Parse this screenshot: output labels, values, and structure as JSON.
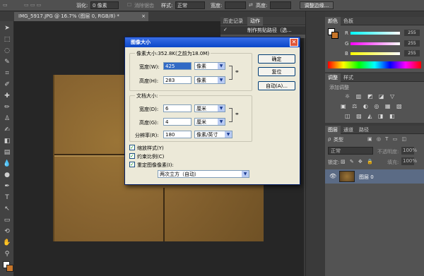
{
  "options_bar": {
    "feather_label": "羽化:",
    "feather_value": "0 像素",
    "antialias_label": "消除锯齿",
    "style_label": "样式:",
    "style_value": "正常",
    "width_label": "宽度:",
    "height_label": "高度:",
    "refine_edge_button": "调整边缘..."
  },
  "document_tab": {
    "title": "IMG_5917.JPG @ 16.7% (图层 0, RGB/8) *",
    "close": "×"
  },
  "history_panel": {
    "tabs": [
      "历史记录",
      "动作"
    ],
    "item": "制作剪贴路径（选..."
  },
  "color_panel": {
    "tabs": [
      "颜色",
      "色板"
    ],
    "channels": [
      {
        "name": "R",
        "value": "255"
      },
      {
        "name": "G",
        "value": "255"
      },
      {
        "name": "B",
        "value": "255"
      }
    ]
  },
  "adjustments_panel": {
    "tabs": [
      "调整",
      "样式"
    ],
    "hint": "添加调整"
  },
  "layers_panel": {
    "tabs": [
      "图层",
      "通道",
      "路径"
    ],
    "kind_label": "类型",
    "blend_mode": "正常",
    "opacity_label": "不透明度:",
    "opacity_value": "100%",
    "lock_label": "锁定:",
    "fill_label": "填充:",
    "fill_value": "100%",
    "layer_name": "图层 0"
  },
  "dialog": {
    "title": "图像大小",
    "pixel_dimensions": "像素大小:352.8K(之前为18.0M)",
    "width_label": "宽度(W):",
    "width_value": "425",
    "width_unit": "像素",
    "height_label": "高度(H):",
    "height_value": "283",
    "height_unit": "像素",
    "document_size": "文档大小:",
    "doc_width_label": "宽度(D):",
    "doc_width_value": "6",
    "doc_width_unit": "厘米",
    "doc_height_label": "高度(G):",
    "doc_height_value": "4",
    "doc_height_unit": "厘米",
    "resolution_label": "分辨率(R):",
    "resolution_value": "180",
    "resolution_unit": "像素/英寸",
    "scale_styles": "缩放样式(Y)",
    "constrain": "约束比例(C)",
    "resample": "重定图像像素(I):",
    "resample_method": "两次立方（自动）",
    "ok": "确定",
    "reset": "复位",
    "auto": "自动(A)..."
  },
  "colors": {
    "canvas_bg": "#262626",
    "cardboard": "#8a6630",
    "highlight": "#0a246a",
    "spectrum_ok": true
  }
}
